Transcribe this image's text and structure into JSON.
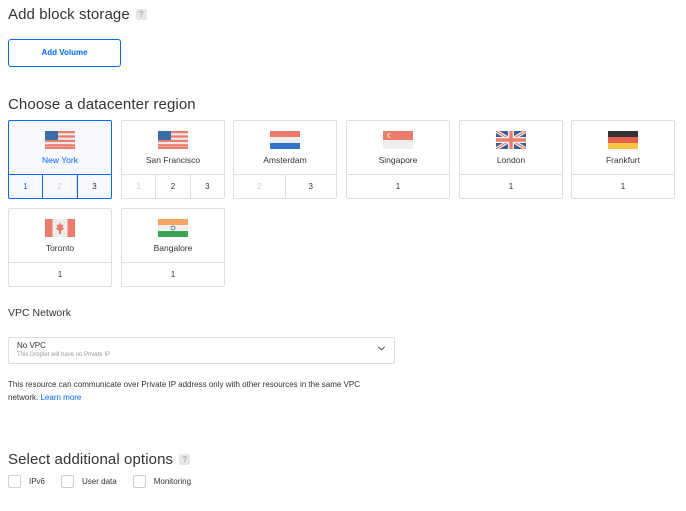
{
  "block_storage": {
    "title": "Add block storage",
    "help": "?",
    "add_button": "Add Volume"
  },
  "datacenter": {
    "title": "Choose a datacenter region",
    "regions": [
      {
        "name": "New York",
        "flag": "us-flag-icon",
        "selected": true,
        "nums": [
          "1",
          "2",
          "3"
        ],
        "selected_num": "1"
      },
      {
        "name": "San Francisco",
        "flag": "us-flag-icon",
        "nums": [
          "1",
          "2",
          "3"
        ]
      },
      {
        "name": "Amsterdam",
        "flag": "netherlands-flag-icon",
        "nums": [
          "2",
          "3"
        ]
      },
      {
        "name": "Singapore",
        "flag": "singapore-flag-icon",
        "nums": [
          "1"
        ]
      },
      {
        "name": "London",
        "flag": "uk-flag-icon",
        "nums": [
          "1"
        ]
      },
      {
        "name": "Frankfurt",
        "flag": "germany-flag-icon",
        "nums": [
          "1"
        ]
      },
      {
        "name": "Toronto",
        "flag": "canada-flag-icon",
        "nums": [
          "1"
        ]
      },
      {
        "name": "Bangalore",
        "flag": "india-flag-icon",
        "nums": [
          "1"
        ]
      }
    ]
  },
  "vpc": {
    "title": "VPC Network",
    "select_value": "No VPC",
    "select_sub": "This Droplet will have no Private IP",
    "description": "This resource can communicate over Private IP address only with other resources in the same VPC network.",
    "learn_more": "Learn more"
  },
  "options": {
    "title": "Select additional options",
    "help": "?",
    "items": [
      {
        "label": "IPv6"
      },
      {
        "label": "User data"
      },
      {
        "label": "Monitoring"
      }
    ]
  },
  "colors": {
    "accent": "#0069ff",
    "border": "#dfdfdf",
    "text": "#333333"
  }
}
